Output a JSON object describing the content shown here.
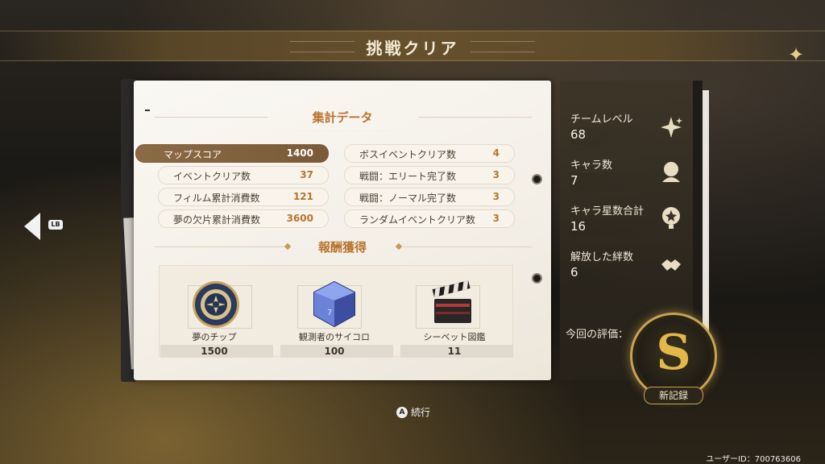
{
  "header": {
    "title": "挑戦クリア"
  },
  "nav": {
    "back_badge": "LB"
  },
  "summary": {
    "title": "集計データ",
    "stats_left": [
      {
        "label": "マップスコア",
        "value": "1400",
        "active": true
      },
      {
        "label": "イベントクリア数",
        "value": "37"
      },
      {
        "label": "フィルム累計消費数",
        "value": "121"
      },
      {
        "label": "夢の欠片累計消費数",
        "value": "3600"
      }
    ],
    "stats_right": [
      {
        "label": "ボスイベントクリア数",
        "value": "4"
      },
      {
        "label": "戦闘：エリート完了数",
        "value": "3"
      },
      {
        "label": "戦闘：ノーマル完了数",
        "value": "3"
      },
      {
        "label": "ランダムイベントクリア数",
        "value": "3"
      }
    ]
  },
  "rewards": {
    "title": "報酬獲得",
    "items": [
      {
        "name": "夢のチップ",
        "qty": "1500",
        "icon": "chip-icon"
      },
      {
        "name": "観測者のサイコロ",
        "qty": "100",
        "icon": "dice-icon"
      },
      {
        "name": "シーベット図鑑",
        "qty": "11",
        "icon": "clapperboard-icon"
      }
    ]
  },
  "side": {
    "stats": [
      {
        "label": "チームレベル",
        "value": "68",
        "icon": "sparkle-icon"
      },
      {
        "label": "キャラ数",
        "value": "7",
        "icon": "character-icon"
      },
      {
        "label": "キャラ星数合計",
        "value": "16",
        "icon": "star-badge-icon"
      },
      {
        "label": "解放した絆数",
        "value": "6",
        "icon": "bond-icon"
      }
    ],
    "evaluation_label": "今回の評価：",
    "rank": "S",
    "new_record": "新記録"
  },
  "footer": {
    "continue_button": "A",
    "continue_label": "続行",
    "user_id": "ユーザーID：700763606"
  }
}
